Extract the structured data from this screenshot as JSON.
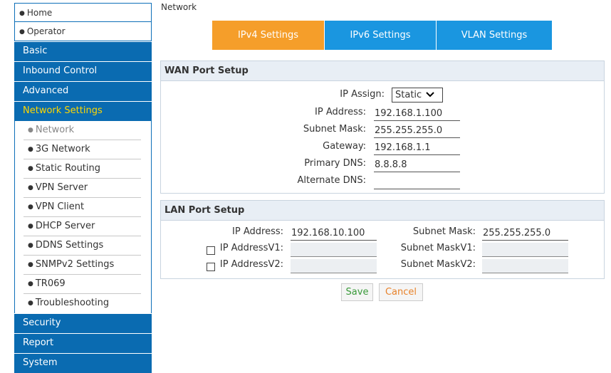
{
  "sidebar": {
    "home": "Home",
    "operator": "Operator",
    "basic": "Basic",
    "inbound": "Inbound Control",
    "advanced": "Advanced",
    "network_settings": "Network Settings",
    "sub_items": [
      "Network",
      "3G Network",
      "Static Routing",
      "VPN Server",
      "VPN Client",
      "DHCP Server",
      "DDNS Settings",
      "SNMPv2 Settings",
      "TR069",
      "Troubleshooting"
    ],
    "security": "Security",
    "report": "Report",
    "system": "System"
  },
  "breadcrumb": "Network",
  "tabs": [
    "IPv4 Settings",
    "IPv6 Settings",
    "VLAN Settings"
  ],
  "wan": {
    "title": "WAN Port Setup",
    "ip_assign_label": "IP Assign:",
    "ip_assign_value": "Static",
    "ip_address_label": "IP Address:",
    "ip_address": "192.168.1.100",
    "subnet_label": "Subnet Mask:",
    "subnet": "255.255.255.0",
    "gateway_label": "Gateway:",
    "gateway": "192.168.1.1",
    "primary_dns_label": "Primary DNS:",
    "primary_dns": "8.8.8.8",
    "alternate_dns_label": "Alternate DNS:",
    "alternate_dns": ""
  },
  "lan": {
    "title": "LAN Port Setup",
    "ip_address_label": "IP Address:",
    "ip_address": "192.168.10.100",
    "subnet_label": "Subnet Mask:",
    "subnet": "255.255.255.0",
    "ipv1_label": "IP AddressV1:",
    "ipv1": "",
    "subnet_v1_label": "Subnet MaskV1:",
    "subnet_v1": "",
    "ipv2_label": "IP AddressV2:",
    "ipv2": "",
    "subnet_v2_label": "Subnet MaskV2:",
    "subnet_v2": ""
  },
  "buttons": {
    "save": "Save",
    "cancel": "Cancel"
  },
  "colors": {
    "nav_blue": "#0a6bb1",
    "active_tab": "#f59e2a",
    "tab_blue": "#1a96e0",
    "active_nav_text": "#ffd700"
  }
}
